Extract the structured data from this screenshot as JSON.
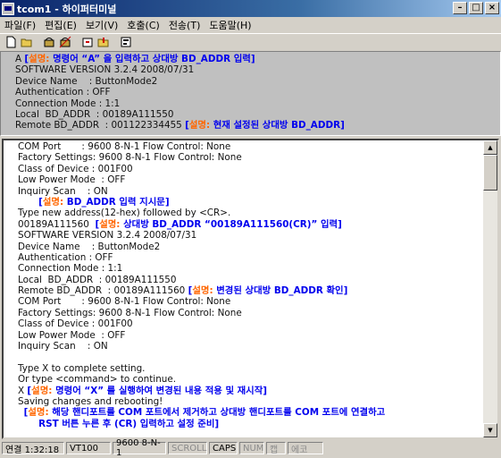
{
  "window": {
    "title": "tcom1 - 하이퍼터미널"
  },
  "menu": [
    "파일(F)",
    "편집(E)",
    "보기(V)",
    "호출(C)",
    "전송(T)",
    "도움말(H)"
  ],
  "upper": [
    [
      {
        "t": "A "
      },
      {
        "a": "[설명: 명령어 “A” 을 입력하고 상대방 BD_ADDR 입력]"
      }
    ],
    [
      {
        "t": "SOFTWARE VERSION 3.2.4 2008/07/31"
      }
    ],
    [
      {
        "t": "Device Name    : ButtonMode2"
      }
    ],
    [
      {
        "t": "Authentication : OFF"
      }
    ],
    [
      {
        "t": "Connection Mode : 1:1"
      }
    ],
    [
      {
        "t": "Local  BD_ADDR  : 00189A111550"
      }
    ],
    [
      {
        "t": "Remote BD_ADDR  : 001122334455 "
      },
      {
        "a": "[설명: 현재 설정된 상대방 BD_ADDR]"
      }
    ]
  ],
  "lower": [
    [
      {
        "t": "COM Port       : 9600 8-N-1 Flow Control: None"
      }
    ],
    [
      {
        "t": "Factory Settings: 9600 8-N-1 Flow Control: None"
      }
    ],
    [
      {
        "t": "Class of Device : 001F00"
      }
    ],
    [
      {
        "t": "Low Power Mode  : OFF"
      }
    ],
    [
      {
        "t": "Inquiry Scan    : ON"
      }
    ],
    [
      {
        "t": "       "
      },
      {
        "a": "[설명: BD_ADDR 입력 지시문]"
      }
    ],
    [
      {
        "t": "Type new address(12-hex) followed by <CR>."
      }
    ],
    [
      {
        "t": "00189A111560  "
      },
      {
        "a": "[설명: 상대방 BD_ADDR “00189A111560(CR)” 입력]"
      }
    ],
    [
      {
        "t": "SOFTWARE VERSION 3.2.4 2008/07/31"
      }
    ],
    [
      {
        "t": "Device Name    : ButtonMode2"
      }
    ],
    [
      {
        "t": "Authentication : OFF"
      }
    ],
    [
      {
        "t": "Connection Mode : 1:1"
      }
    ],
    [
      {
        "t": "Local  BD_ADDR  : 00189A111550"
      }
    ],
    [
      {
        "t": "Remote BD_ADDR  : 00189A111560 "
      },
      {
        "a": "[설명: 변경된 상대방 BD_ADDR 확인]"
      }
    ],
    [
      {
        "t": "COM Port       : 9600 8-N-1 Flow Control: None"
      }
    ],
    [
      {
        "t": "Factory Settings: 9600 8-N-1 Flow Control: None"
      }
    ],
    [
      {
        "t": "Class of Device : 001F00"
      }
    ],
    [
      {
        "t": "Low Power Mode  : OFF"
      }
    ],
    [
      {
        "t": "Inquiry Scan    : ON"
      }
    ],
    [
      {
        "t": ""
      }
    ],
    [
      {
        "t": "Type X to complete setting."
      }
    ],
    [
      {
        "t": "Or type <command> to continue."
      }
    ],
    [
      {
        "t": "X "
      },
      {
        "a": "[설명: 명령어 “X” 를 실행하여 변경된 내용 적용 및 재시작]"
      }
    ],
    [
      {
        "t": "Saving changes and rebooting!"
      }
    ],
    [
      {
        "t": "  "
      },
      {
        "a": "[설명: 해당 핸디포트를 COM 포트에서 제거하고 상대방 핸디포트를 COM 포트에 연결하고"
      }
    ],
    [
      {
        "t": "       "
      },
      {
        "a": "RST 버튼 누른 후 (CR) 입력하고 설정 준비]"
      }
    ]
  ],
  "status": {
    "connected": "연결 1:32:18",
    "emulation": "VT100",
    "port": "9600 8-N-1",
    "scroll": "SCROLL",
    "caps": "CAPS",
    "num": "NUM",
    "capture": "캡",
    "print": "에코"
  }
}
